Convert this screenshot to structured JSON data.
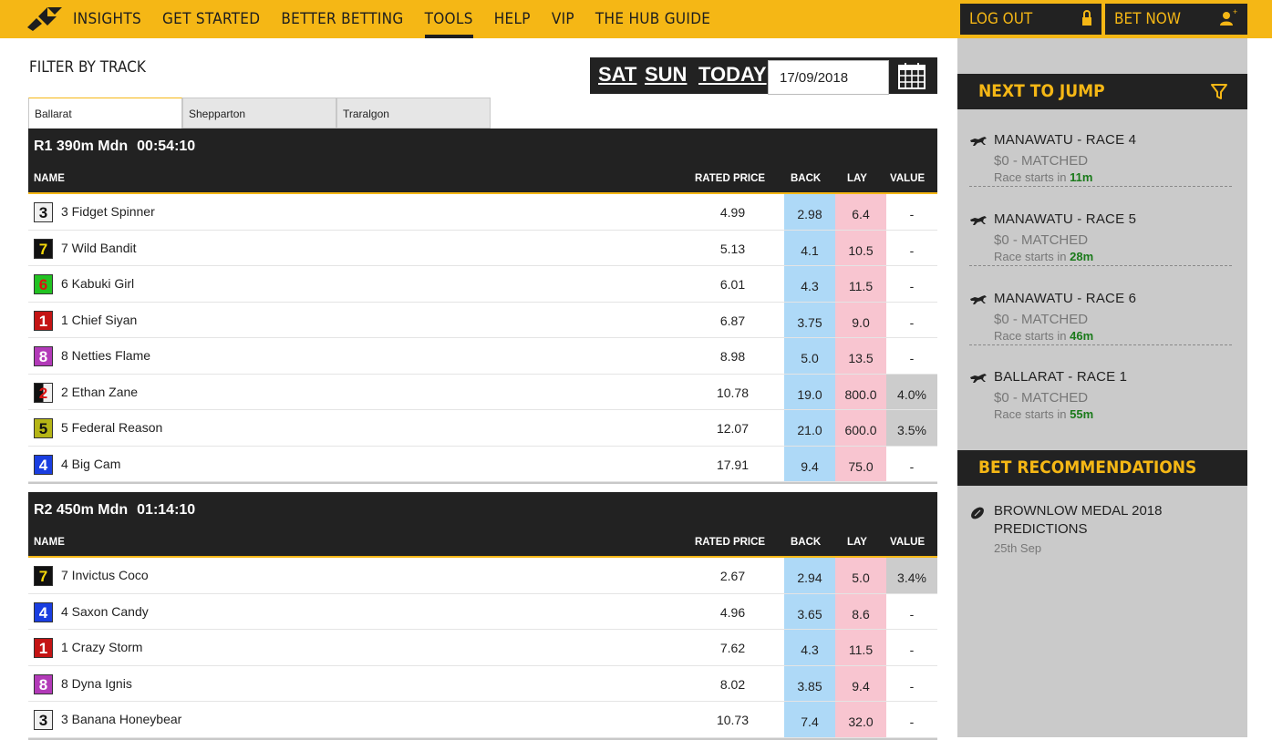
{
  "nav": {
    "items": [
      {
        "label": "INSIGHTS",
        "active": false
      },
      {
        "label": "GET STARTED",
        "active": false
      },
      {
        "label": "BETTER BETTING",
        "active": false
      },
      {
        "label": "TOOLS",
        "active": true
      },
      {
        "label": "HELP",
        "active": false
      },
      {
        "label": "VIP",
        "active": false
      },
      {
        "label": "THE HUB GUIDE",
        "active": false
      }
    ],
    "logout_label": "LOG OUT",
    "betnow_label": "BET NOW"
  },
  "filter": {
    "title": "FILTER BY TRACK",
    "days": [
      "SAT",
      "SUN",
      "TODAY"
    ],
    "date": "17/09/2018",
    "tracks": [
      "Ballarat",
      "Shepparton",
      "Traralgon"
    ],
    "active_track": 0
  },
  "columns": {
    "name": "NAME",
    "rated": "RATED PRICE",
    "back": "BACK",
    "lay": "LAY",
    "value": "VALUE"
  },
  "races": [
    {
      "title": "R1 390m Mdn",
      "time": "00:54:10",
      "runners": [
        {
          "num": "3",
          "rug": "white",
          "name": "3 Fidget Spinner",
          "rated": "4.99",
          "back": "2.98",
          "lay": "6.4",
          "value": "-"
        },
        {
          "num": "7",
          "rug": "black-yellow",
          "name": "7 Wild Bandit",
          "rated": "5.13",
          "back": "4.1",
          "lay": "10.5",
          "value": "-"
        },
        {
          "num": "6",
          "rug": "green",
          "name": "6 Kabuki Girl",
          "rated": "6.01",
          "back": "4.3",
          "lay": "11.5",
          "value": "-"
        },
        {
          "num": "1",
          "rug": "red",
          "name": "1 Chief Siyan",
          "rated": "6.87",
          "back": "3.75",
          "lay": "9.0",
          "value": "-"
        },
        {
          "num": "8",
          "rug": "pink",
          "name": "8 Netties Flame",
          "rated": "8.98",
          "back": "5.0",
          "lay": "13.5",
          "value": "-"
        },
        {
          "num": "2",
          "rug": "black-white",
          "name": "2 Ethan Zane",
          "rated": "10.78",
          "back": "19.0",
          "lay": "800.0",
          "value": "4.0%"
        },
        {
          "num": "5",
          "rug": "yellow",
          "name": "5 Federal Reason",
          "rated": "12.07",
          "back": "21.0",
          "lay": "600.0",
          "value": "3.5%"
        },
        {
          "num": "4",
          "rug": "blue",
          "name": "4 Big Cam",
          "rated": "17.91",
          "back": "9.4",
          "lay": "75.0",
          "value": "-"
        }
      ]
    },
    {
      "title": "R2 450m Mdn",
      "time": "01:14:10",
      "runners": [
        {
          "num": "7",
          "rug": "black-yellow",
          "name": "7 Invictus Coco",
          "rated": "2.67",
          "back": "2.94",
          "lay": "5.0",
          "value": "3.4%"
        },
        {
          "num": "4",
          "rug": "blue",
          "name": "4 Saxon Candy",
          "rated": "4.96",
          "back": "3.65",
          "lay": "8.6",
          "value": "-"
        },
        {
          "num": "1",
          "rug": "red",
          "name": "1 Crazy Storm",
          "rated": "7.62",
          "back": "4.3",
          "lay": "11.5",
          "value": "-"
        },
        {
          "num": "8",
          "rug": "pink",
          "name": "8 Dyna Ignis",
          "rated": "8.02",
          "back": "3.85",
          "lay": "9.4",
          "value": "-"
        },
        {
          "num": "3",
          "rug": "white",
          "name": "3 Banana Honeybear",
          "rated": "10.73",
          "back": "7.4",
          "lay": "32.0",
          "value": "-"
        }
      ]
    }
  ],
  "next_to_jump": {
    "title": "NEXT TO JUMP",
    "items": [
      {
        "title": "MANAWATU - RACE 4",
        "matched": "$0 - MATCHED",
        "starts_prefix": "Race starts in",
        "starts_in": "11m"
      },
      {
        "title": "MANAWATU - RACE 5",
        "matched": "$0 - MATCHED",
        "starts_prefix": "Race starts in",
        "starts_in": "28m"
      },
      {
        "title": "MANAWATU - RACE 6",
        "matched": "$0 - MATCHED",
        "starts_prefix": "Race starts in",
        "starts_in": "46m"
      },
      {
        "title": "BALLARAT - RACE 1",
        "matched": "$0 - MATCHED",
        "starts_prefix": "Race starts in",
        "starts_in": "55m"
      }
    ]
  },
  "recommendations": {
    "title": "BET RECOMMENDATIONS",
    "items": [
      {
        "title": "BROWNLOW MEDAL 2018 PREDICTIONS",
        "date": "25th Sep"
      }
    ]
  },
  "colors": {
    "accent": "#f5b715",
    "dark": "#222222",
    "back": "#aed9f7",
    "lay": "#f8c5d0",
    "panel": "#cacaca",
    "green": "#1a7a1a"
  }
}
